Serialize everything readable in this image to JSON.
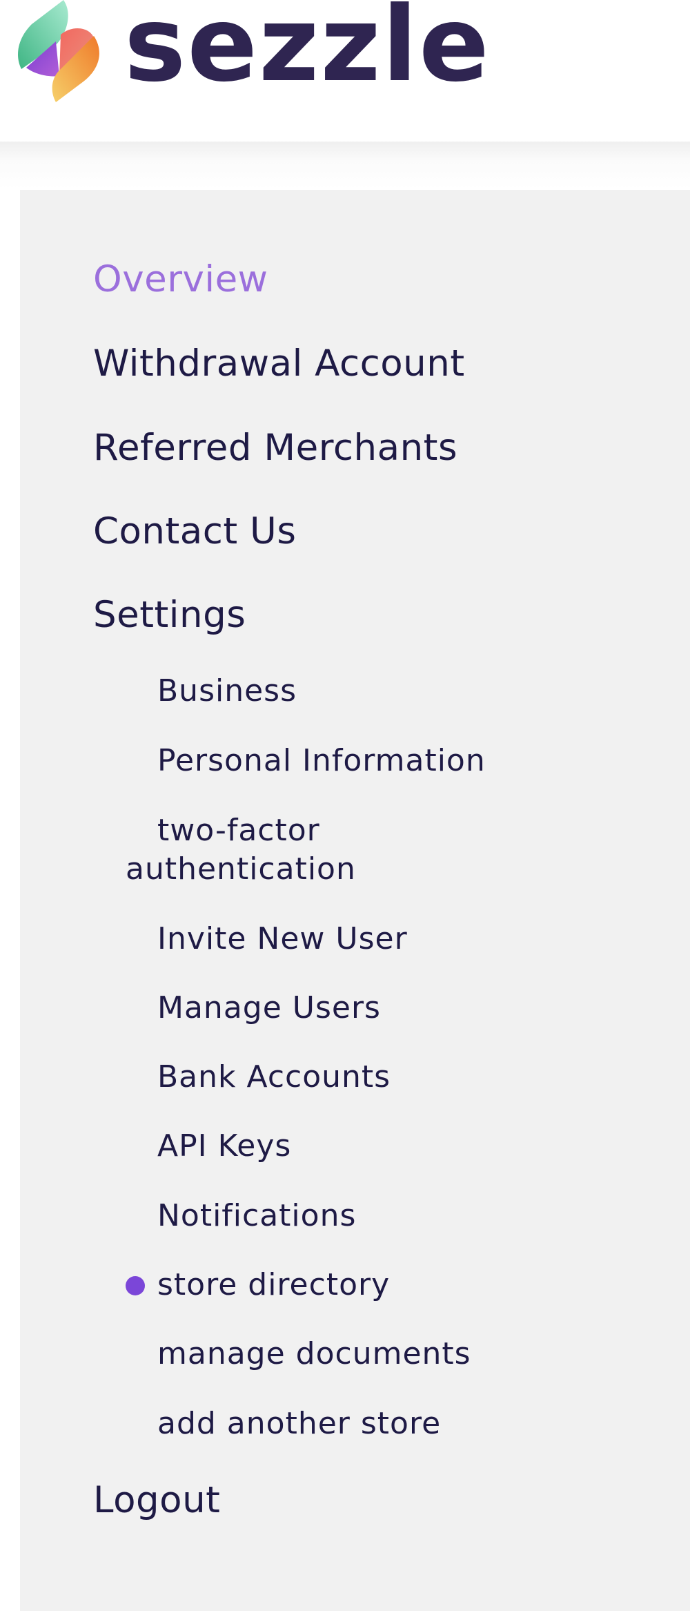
{
  "brand": {
    "name": "sezzle",
    "text_color": "#2f2551",
    "logo_colors": {
      "green": "#5cc79a",
      "purple": "#9353d6",
      "coral": "#ef6f6c",
      "orange": "#f39a3a",
      "yellow": "#f6c762"
    }
  },
  "nav": {
    "active_color": "#9b6fdc",
    "text_color": "#1e1a45",
    "items": [
      {
        "label": "Overview",
        "active": true
      },
      {
        "label": "Withdrawal Account"
      },
      {
        "label": "Referred Merchants"
      },
      {
        "label": "Contact Us"
      },
      {
        "label": "Settings"
      }
    ],
    "settings_subitems": [
      {
        "label": "Business"
      },
      {
        "label": "Personal Information"
      },
      {
        "label_line1": "two-factor",
        "label_line2": "authentication"
      },
      {
        "label": "Invite New User"
      },
      {
        "label": "Manage Users"
      },
      {
        "label": "Bank Accounts"
      },
      {
        "label": "API Keys"
      },
      {
        "label": "Notifications"
      },
      {
        "label": "store directory",
        "current": true
      },
      {
        "label": "manage documents"
      },
      {
        "label": "add another store"
      }
    ],
    "current_marker_color": "#7b46d8",
    "logout": {
      "label": "Logout"
    }
  }
}
